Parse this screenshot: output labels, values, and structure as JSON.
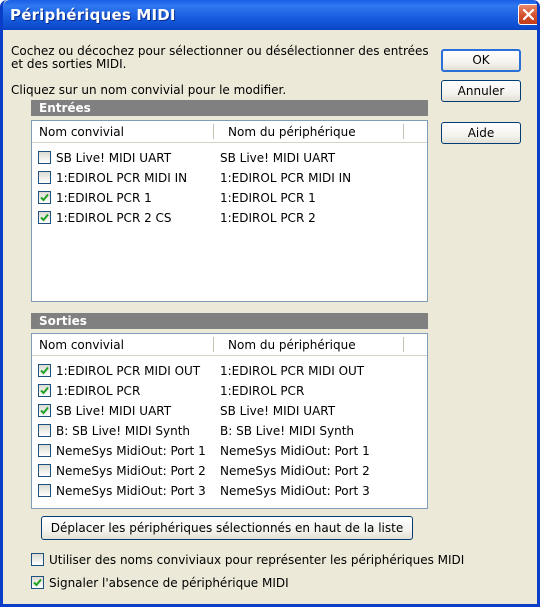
{
  "window": {
    "title": "Périphériques MIDI",
    "close_icon": "close-icon"
  },
  "instructions": {
    "line1": "Cochez ou décochez pour sélectionner ou désélectionner des entrées",
    "line2": "et des sorties MIDI.",
    "line3": "Cliquez sur un nom convivial pour le modifier."
  },
  "buttons": {
    "ok": "OK",
    "cancel": "Annuler",
    "help": "Aide",
    "move_up": "Déplacer les périphériques sélectionnés en haut de la liste"
  },
  "inputs": {
    "section": "Entrées",
    "col_friendly": "Nom convivial",
    "col_device": "Nom du périphérique",
    "rows": [
      {
        "checked": false,
        "friendly": "SB Live! MIDI UART",
        "device": "SB Live! MIDI UART"
      },
      {
        "checked": false,
        "friendly": "1:EDIROL PCR MIDI IN",
        "device": "1:EDIROL PCR MIDI IN"
      },
      {
        "checked": true,
        "friendly": "1:EDIROL PCR 1",
        "device": "1:EDIROL PCR 1"
      },
      {
        "checked": true,
        "friendly": "1:EDIROL PCR 2 CS",
        "device": "1:EDIROL PCR 2"
      }
    ]
  },
  "outputs": {
    "section": "Sorties",
    "col_friendly": "Nom convivial",
    "col_device": "Nom du périphérique",
    "rows": [
      {
        "checked": true,
        "friendly": "1:EDIROL PCR MIDI OUT",
        "device": "1:EDIROL PCR MIDI OUT"
      },
      {
        "checked": true,
        "friendly": "1:EDIROL PCR",
        "device": "1:EDIROL PCR"
      },
      {
        "checked": true,
        "friendly": "SB Live! MIDI UART",
        "device": "SB Live! MIDI UART"
      },
      {
        "checked": false,
        "friendly": "B: SB Live! MIDI Synth",
        "device": "B: SB Live! MIDI Synth"
      },
      {
        "checked": false,
        "friendly": "NemeSys MidiOut: Port 1",
        "device": "NemeSys MidiOut: Port 1"
      },
      {
        "checked": false,
        "friendly": "NemeSys MidiOut: Port 2",
        "device": "NemeSys MidiOut: Port 2"
      },
      {
        "checked": false,
        "friendly": "NemeSys MidiOut: Port 3",
        "device": "NemeSys MidiOut: Port 3"
      }
    ]
  },
  "options": {
    "use_friendly": {
      "label": "Utiliser des noms conviviaux pour représenter les périphériques MIDI",
      "checked": false
    },
    "signal_absence": {
      "label": "Signaler l'absence de périphérique MIDI",
      "checked": true
    }
  },
  "colors": {
    "titlebar": "#0a4fd2",
    "dialog": "#ece9d8",
    "section_header": "#808080",
    "check": "#21a121"
  }
}
